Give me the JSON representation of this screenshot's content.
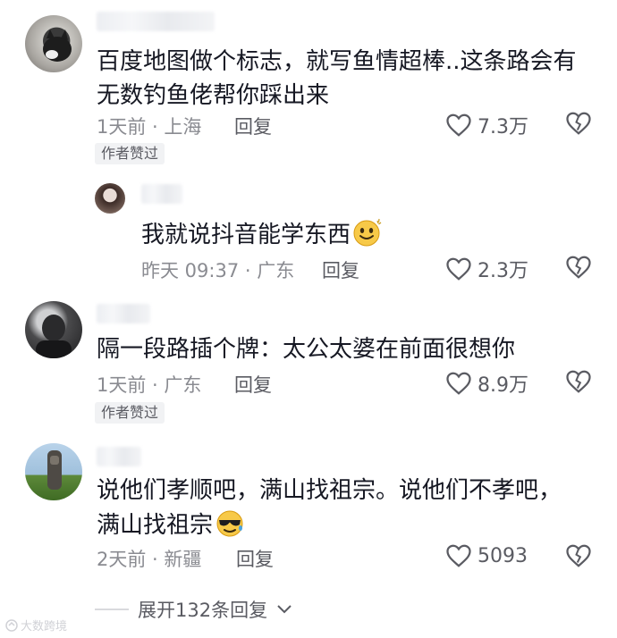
{
  "comments": [
    {
      "text_lines": [
        "百度地图做个标志，就写鱼情超棒..这条路会有",
        "无数钓鱼佬帮你踩出来"
      ],
      "meta": "1天前 · 上海",
      "reply_label": "回复",
      "likes": "7.3万",
      "badge": "作者赞过"
    },
    {
      "text_lines": [
        "我就说抖音能学东西"
      ],
      "meta": "昨天 09:37 · 广东",
      "reply_label": "回复",
      "likes": "2.3万"
    },
    {
      "text_lines": [
        "隔一段路插个牌：太公太婆在前面很想你"
      ],
      "meta": "1天前 · 广东",
      "reply_label": "回复",
      "likes": "8.9万",
      "badge": "作者赞过"
    },
    {
      "text_lines": [
        "说他们孝顺吧，满山找祖宗。说他们不孝吧，",
        "满山找祖宗"
      ],
      "meta": "2天前 · 新疆",
      "reply_label": "回复",
      "likes": "5093"
    }
  ],
  "expand_label": "展开132条回复",
  "watermark": "大数跨境",
  "icons": {
    "like": "heart-outline-icon",
    "dislike": "broken-heart-icon",
    "expand": "chevron-down-icon",
    "emoji_1": "smile-emoji-icon",
    "emoji_2": "sunglasses-emoji-icon"
  }
}
